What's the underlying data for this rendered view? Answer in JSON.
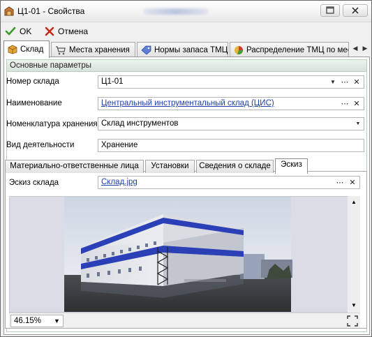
{
  "window": {
    "title": "Ц1-01 - Свойства"
  },
  "toolbar": {
    "ok_label": "OK",
    "cancel_label": "Отмена"
  },
  "main_tabs": [
    {
      "label": "Склад"
    },
    {
      "label": "Места хранения"
    },
    {
      "label": "Нормы запаса ТМЦ"
    },
    {
      "label": "Распределение ТМЦ по мест"
    }
  ],
  "group": {
    "title": "Основные параметры"
  },
  "fields": {
    "number": {
      "label": "Номер склада",
      "value": "Ц1-01"
    },
    "name": {
      "label": "Наименование",
      "value": "Центральный инструментальный склад (ЦИС)"
    },
    "nomenclature": {
      "label": "Номенклатура хранения",
      "value": "Склад инструментов"
    },
    "activity": {
      "label": "Вид деятельности",
      "value": "Хранение"
    }
  },
  "sub_tabs": [
    {
      "label": "Материально-ответственные лица"
    },
    {
      "label": "Установки"
    },
    {
      "label": "Сведения о складе"
    },
    {
      "label": "Эскиз"
    }
  ],
  "sketch": {
    "label": "Эскиз склада",
    "file": "Склад.jpg",
    "zoom": "46.15%"
  },
  "colors": {
    "link": "#1f3fa8",
    "group_header": "#d6e4d8",
    "building_stripe": "#2b3fb6"
  }
}
